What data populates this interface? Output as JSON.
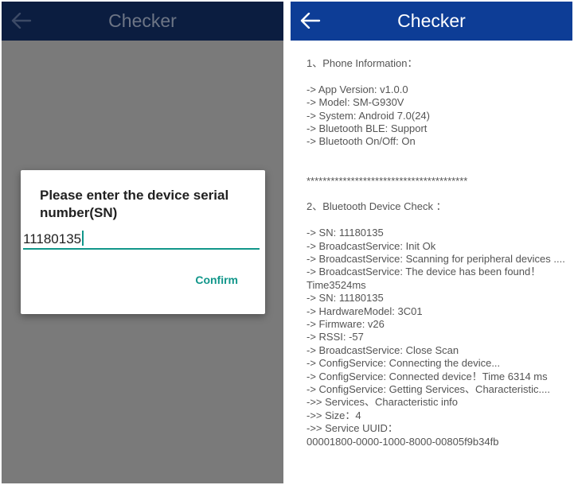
{
  "left": {
    "title": "Checker",
    "dialog": {
      "title": "Please enter the device serial number(SN)",
      "input_value": "11180135",
      "confirm_label": "Confirm"
    }
  },
  "right": {
    "title": "Checker",
    "log": [
      "1、Phone Information：",
      "",
      "-> App Version: v1.0.0",
      "-> Model: SM-G930V",
      "-> System: Android 7.0(24)",
      "-> Bluetooth BLE: Support",
      "-> Bluetooth On/Off: On",
      "",
      "",
      "****************************************",
      "",
      "2、Bluetooth Device Check ：",
      "",
      "-> SN: 11180135",
      "-> BroadcastService: Init Ok",
      "-> BroadcastService: Scanning for peripheral devices ....",
      "-> BroadcastService: The device has been found！Time3524ms",
      "-> SN: 11180135",
      "-> HardwareModel: 3C01",
      "-> Firmware: v26",
      "-> RSSI: -57",
      "-> BroadcastService: Close Scan",
      "-> ConfigService: Connecting the device...",
      "-> ConfigService: Connected device！Time 6314 ms",
      "-> ConfigService: Getting Services、Characteristic....",
      "->> Services、Characteristic info",
      "->> Size：4",
      "->> Service UUID：",
      "00001800-0000-1000-8000-00805f9b34fb"
    ]
  }
}
